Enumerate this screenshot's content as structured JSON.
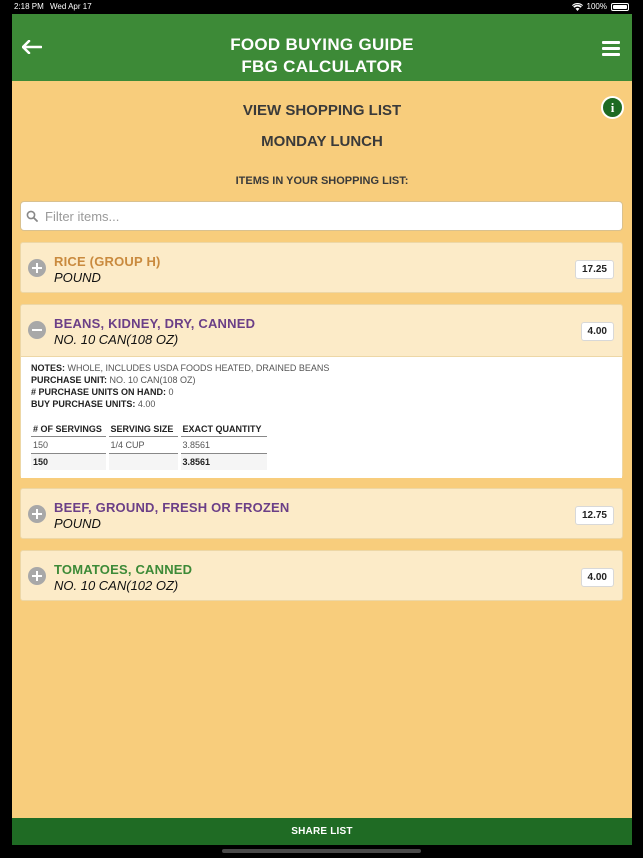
{
  "status_bar": {
    "time": "2:18 PM",
    "date": "Wed Apr 17",
    "battery": "100%"
  },
  "header": {
    "title_line1": "FOOD BUYING GUIDE",
    "title_line2": "FBG CALCULATOR"
  },
  "page": {
    "title": "VIEW SHOPPING LIST",
    "subtitle": "MONDAY LUNCH",
    "list_heading": "ITEMS IN YOUR SHOPPING LIST:",
    "filter_placeholder": "Filter items..."
  },
  "items": [
    {
      "name": "RICE (GROUP H)",
      "unit": "POUND",
      "quantity": "17.25",
      "name_color": "#c98a3e",
      "expanded": false
    },
    {
      "name": "BEANS, KIDNEY, DRY, CANNED",
      "unit": "NO. 10 CAN(108 OZ)",
      "quantity": "4.00",
      "name_color": "#6b3f87",
      "expanded": true,
      "details": {
        "notes_label": "NOTES:",
        "notes": "WHOLE, INCLUDES USDA FOODS HEATED, DRAINED BEANS",
        "purchase_unit_label": "PURCHASE UNIT:",
        "purchase_unit": "NO. 10 CAN(108 OZ)",
        "on_hand_label": "# PURCHASE UNITS ON HAND:",
        "on_hand": "0",
        "buy_label": "BUY PURCHASE UNITS:",
        "buy": "4.00",
        "table_headers": [
          "# OF SERVINGS",
          "SERVING SIZE",
          "EXACT QUANTITY"
        ],
        "rows": [
          [
            "150",
            "1/4 CUP",
            "3.8561"
          ]
        ],
        "total": [
          "150",
          "",
          "3.8561"
        ]
      }
    },
    {
      "name": "BEEF, GROUND, FRESH OR FROZEN",
      "unit": "POUND",
      "quantity": "12.75",
      "name_color": "#6b3f87",
      "expanded": false
    },
    {
      "name": "TOMATOES, CANNED",
      "unit": "NO. 10 CAN(102 OZ)",
      "quantity": "4.00",
      "name_color": "#3d8a37",
      "expanded": false
    }
  ],
  "footer": {
    "share_label": "SHARE LIST"
  },
  "colors": {
    "header_green": "#3d8a37",
    "background": "#f8cd7c",
    "card": "#fcebc8",
    "share_green": "#1f6b24"
  }
}
